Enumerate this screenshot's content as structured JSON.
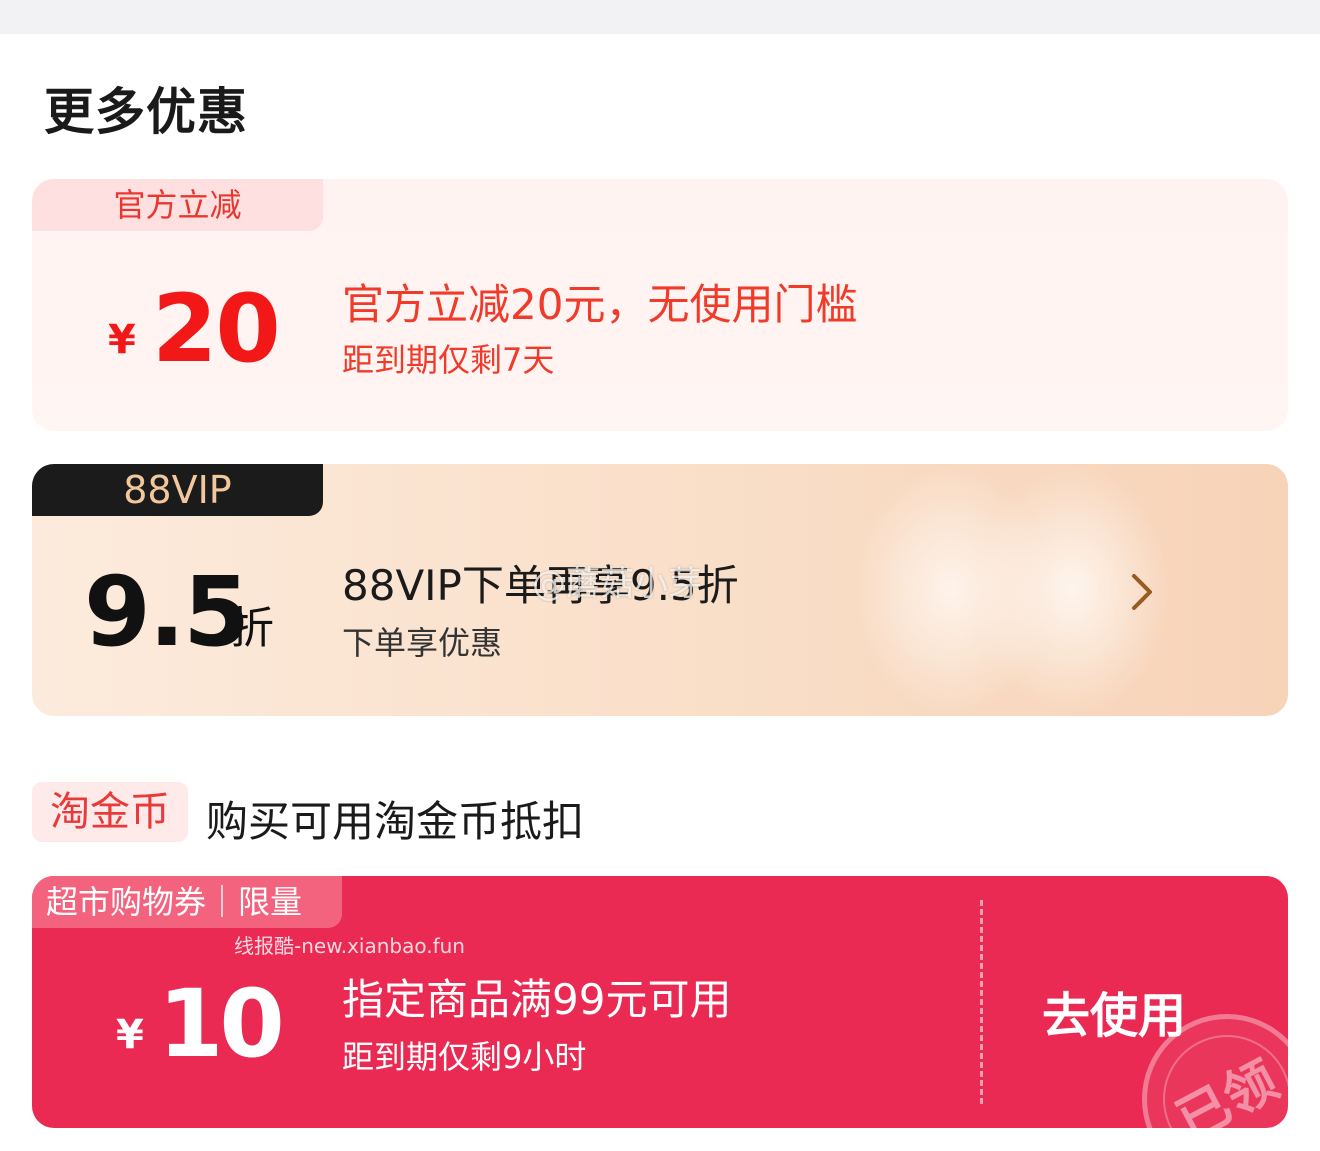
{
  "section": {
    "title": "更多优惠"
  },
  "official_card": {
    "tag": "官方立减",
    "currency": "¥",
    "amount": "20",
    "description": "官方立减20元，无使用门槛",
    "expiry": "距到期仅剩7天"
  },
  "vip_card": {
    "tag": "88VIP",
    "discount": "9.5",
    "unit": "折",
    "description": "88VIP下单再享9.5折",
    "sub": "下单享优惠",
    "chevron_icon": "chevron-right-icon"
  },
  "taocoin": {
    "badge": "淘金币",
    "description": "购买可用淘金币抵扣"
  },
  "coupon_card": {
    "tag": "超市购物券｜限量",
    "currency": "¥",
    "amount": "10",
    "condition": "指定商品满99元可用",
    "expiry": "距到期仅剩9小时",
    "button": "去使用",
    "stamp": "已领"
  },
  "watermarks": {
    "weibo": "@蘑菇小芽",
    "site": "线报酷-new.xianbao.fun"
  },
  "colors": {
    "red": "#f21818",
    "coupon_red": "#ea2a52",
    "vip_gold": "#f3c79d"
  }
}
